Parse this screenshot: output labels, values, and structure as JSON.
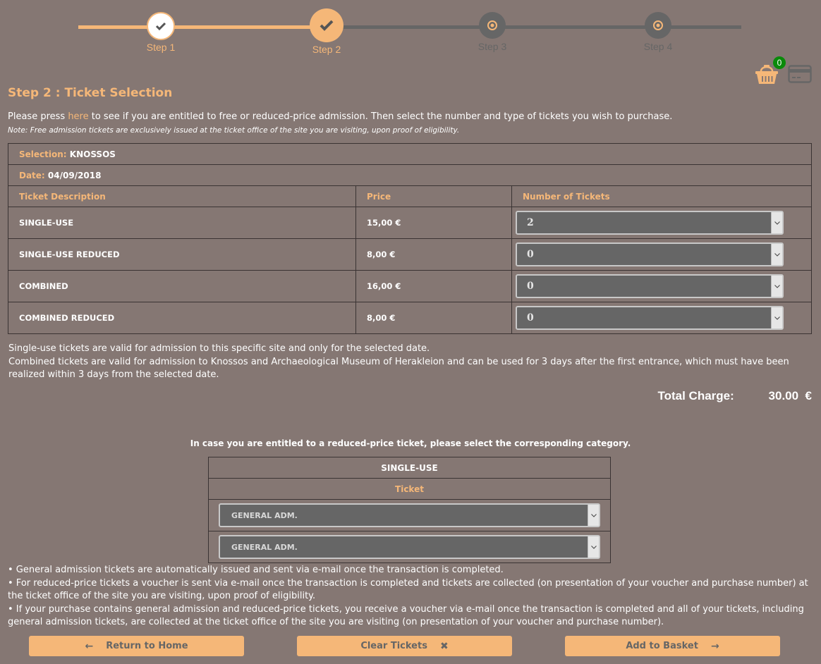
{
  "stepper": {
    "steps": [
      {
        "label": "Step 1",
        "state": "done"
      },
      {
        "label": "Step 2",
        "state": "current"
      },
      {
        "label": "Step 3",
        "state": "todo"
      },
      {
        "label": "Step 4",
        "state": "todo"
      }
    ]
  },
  "cart": {
    "count": "0",
    "basket_icon": "basket-icon",
    "card_icon": "credit-card-icon"
  },
  "page": {
    "title": "Step 2 : Ticket Selection",
    "intro_before": "Please press ",
    "intro_link": "here",
    "intro_after": " to see if you are entitled to free or reduced-price admission. Then select the number and type of tickets you wish to purchase.",
    "note": "Note: Free admission tickets are exclusively issued at the ticket office of the site you are visiting, upon proof of eligibility."
  },
  "selection": {
    "selection_label": "Selection:",
    "selection_value": "KNOSSOS",
    "date_label": "Date:",
    "date_value": "04/09/2018"
  },
  "table": {
    "headers": [
      "Ticket Description",
      "Price",
      "Number of Tickets"
    ],
    "rows": [
      {
        "description": "SINGLE-USE",
        "price": "15,00 €",
        "quantity": "2"
      },
      {
        "description": "SINGLE-USE REDUCED",
        "price": "8,00 €",
        "quantity": "0"
      },
      {
        "description": "COMBINED",
        "price": "16,00 €",
        "quantity": "0"
      },
      {
        "description": "COMBINED REDUCED",
        "price": "8,00 €",
        "quantity": "0"
      }
    ]
  },
  "validity": {
    "line1": "Single-use tickets are valid for admission to this specific site and only for the selected date.",
    "line2": "Combined tickets are valid for admission to Knossos and Archaeological Museum of Herakleion and can be used for 3 days after the first entrance, which must have been realized within 3 days from the selected date."
  },
  "total": {
    "label": "Total Charge:",
    "amount": "30.00",
    "currency": "€"
  },
  "reduced": {
    "caption": "In case you are entitled to a reduced-price ticket, please select the corresponding category.",
    "ticket_type": "SINGLE-USE",
    "column_header": "Ticket",
    "selects": [
      "GENERAL ADM.",
      "GENERAL ADM."
    ]
  },
  "bullets": [
    "• General admission tickets are automatically issued and sent via e-mail once the transaction is completed.",
    "• For reduced-price tickets a voucher is sent via e-mail once the transaction is completed and tickets are collected (on presentation of your voucher and purchase number) at the ticket office of the site you are visiting, upon proof of eligibility.",
    "• If your purchase contains general admission and reduced-price tickets, you receive a voucher via e-mail once the transaction is completed and all of your tickets, including general admission tickets, are collected at the ticket office of the site you are visiting (on presentation of your voucher and purchase number)."
  ],
  "buttons": {
    "home": "Return to Home",
    "clear": "Clear Tickets",
    "add": "Add to Basket"
  },
  "colors": {
    "accent": "#f5b778",
    "background": "#857773",
    "inactive": "#666666",
    "badge": "#0a8a0a"
  }
}
